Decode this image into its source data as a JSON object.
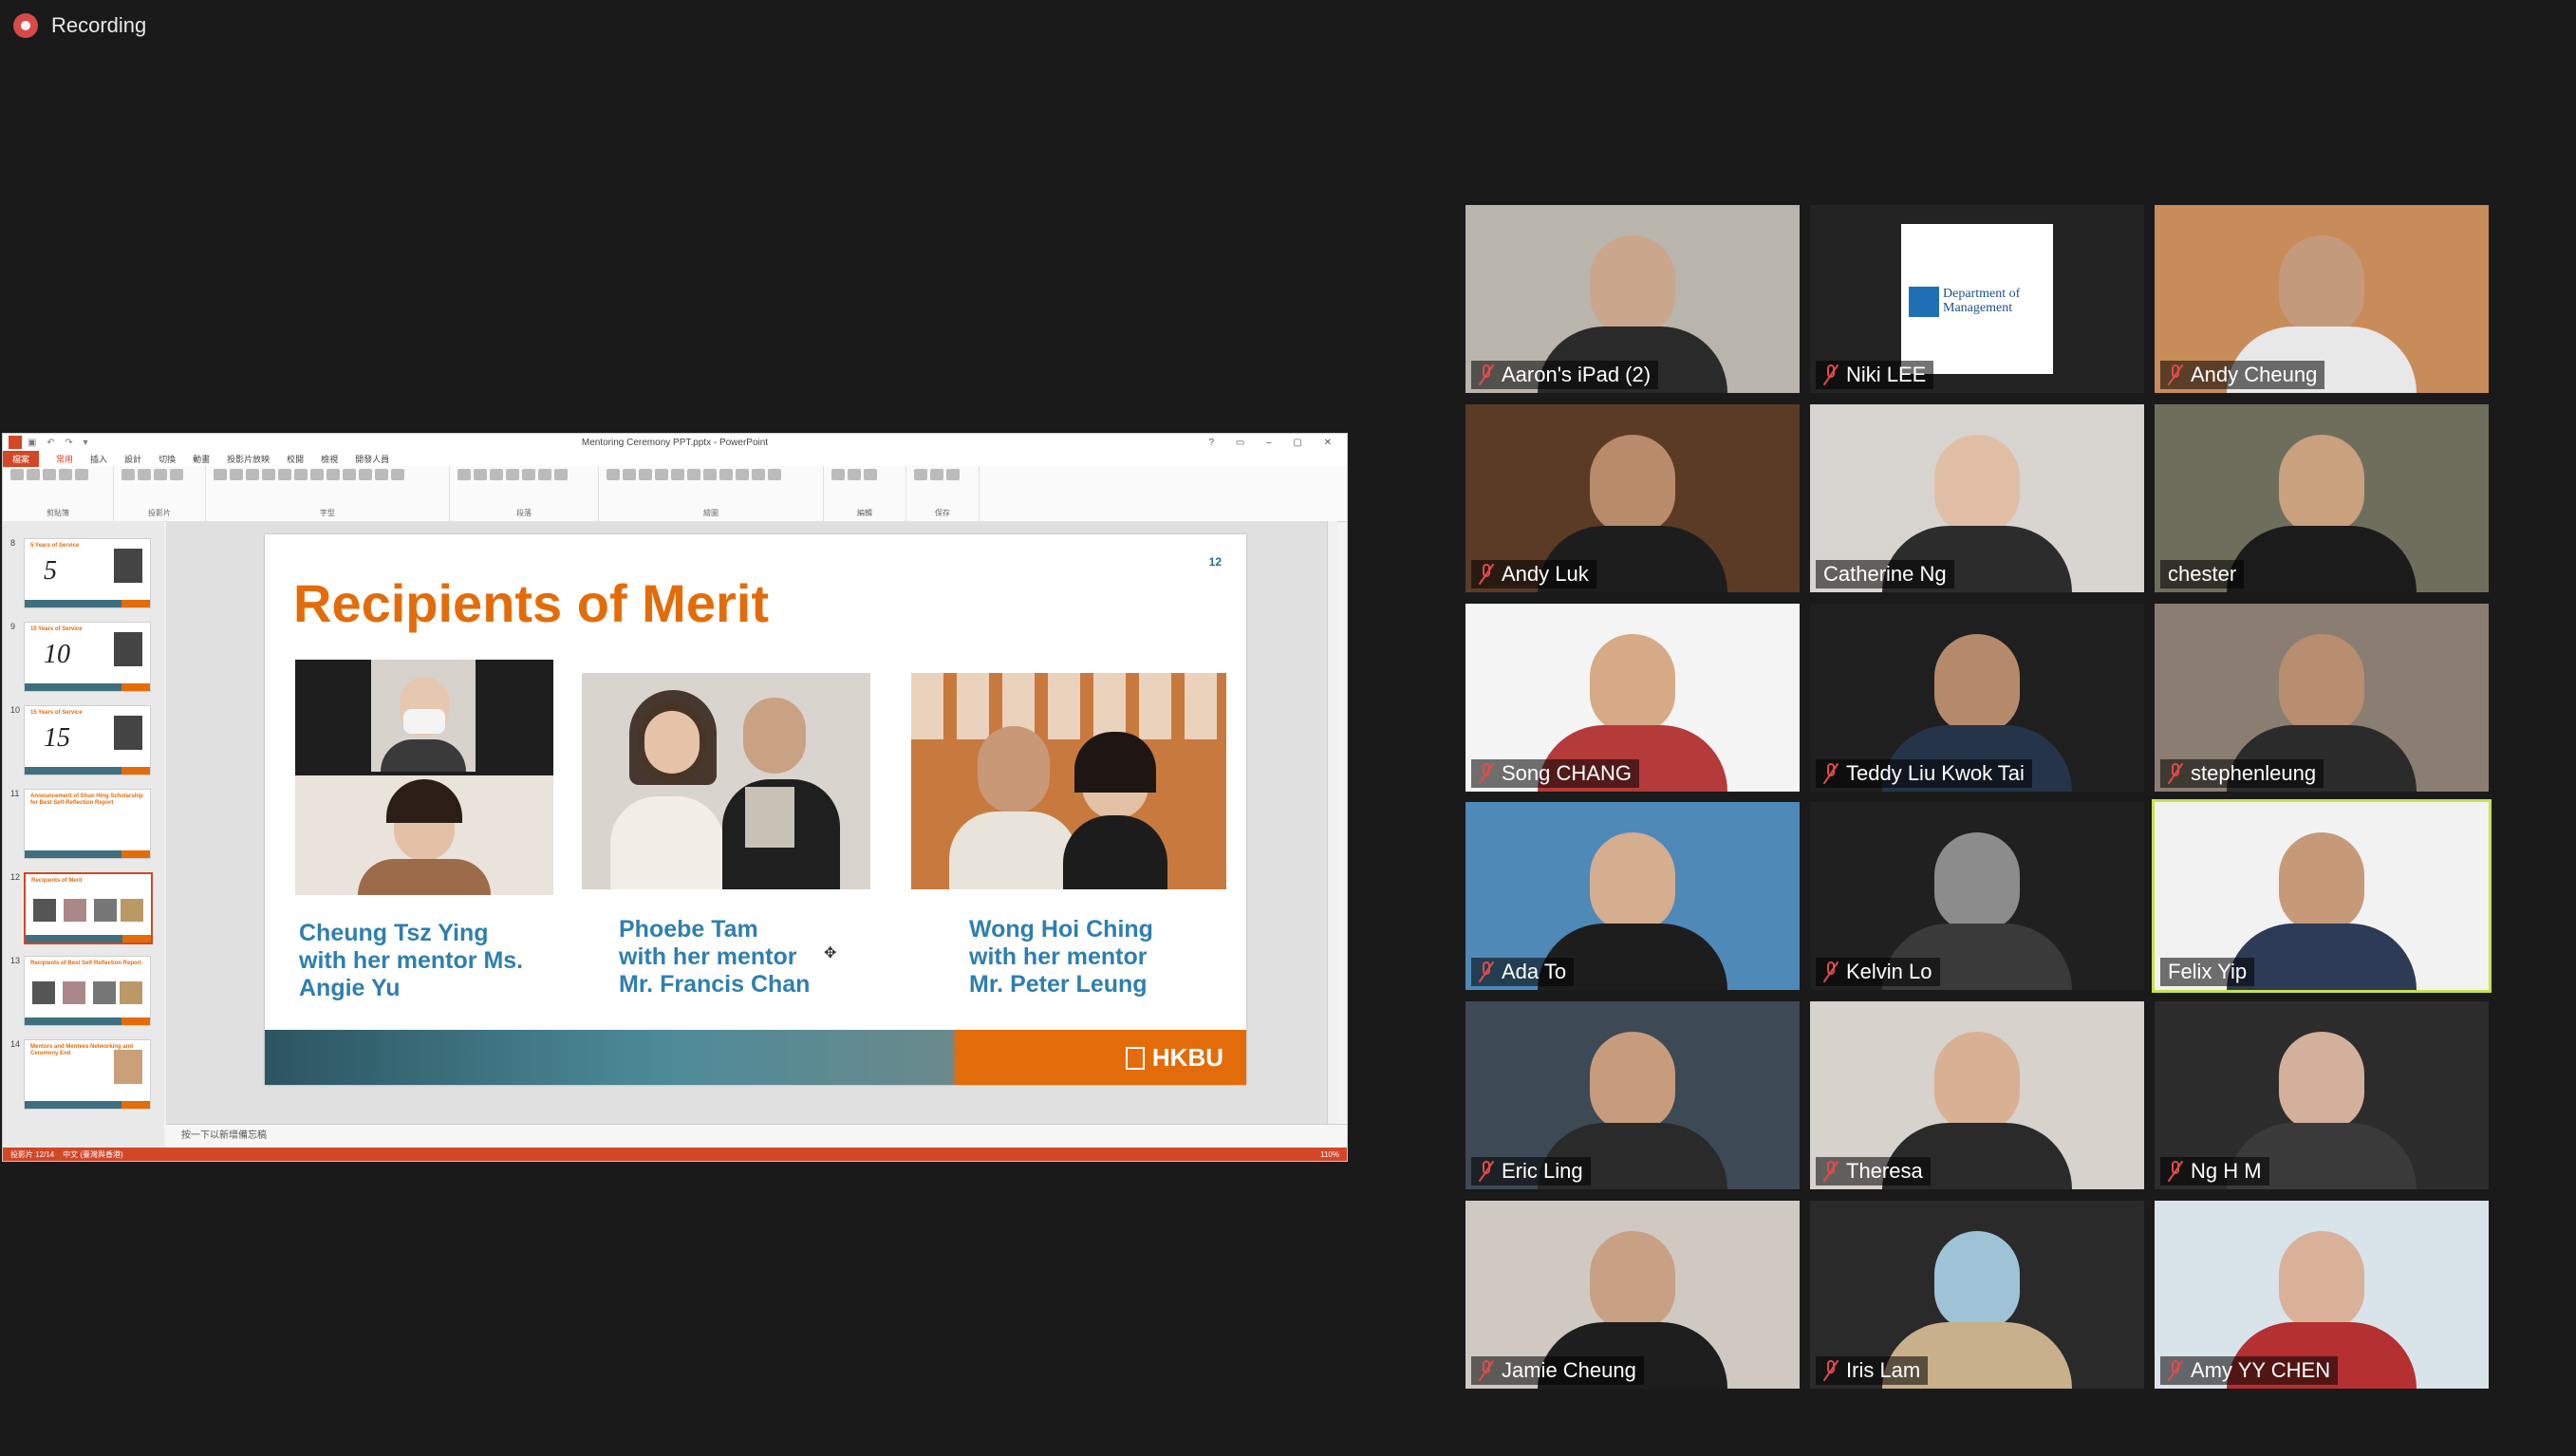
{
  "recording": {
    "label": "Recording"
  },
  "powerpoint": {
    "window_title": "Mentoring Ceremony PPT.pptx - PowerPoint",
    "ribbon_tabs": [
      "檔案",
      "常用",
      "插入",
      "設計",
      "切換",
      "動畫",
      "投影片放映",
      "校閱",
      "檢視",
      "開發人員"
    ],
    "ribbon_groups": [
      "剪貼簿",
      "投影片",
      "字型",
      "段落",
      "繪圖",
      "編輯",
      "保存"
    ],
    "thumbnails": [
      {
        "num": "8",
        "title": "5 Years of Service",
        "big": "5"
      },
      {
        "num": "9",
        "title": "10 Years of Service",
        "big": "10"
      },
      {
        "num": "10",
        "title": "15 Years of Service",
        "big": "15"
      },
      {
        "num": "11",
        "title": "Announcement of Shun Hing Scholarship for Best Self-Reflection Report",
        "big": ""
      },
      {
        "num": "12",
        "title": "Recipients of Merit",
        "big": ""
      },
      {
        "num": "13",
        "title": "Recipients of Best Self-Reflection Report",
        "big": ""
      },
      {
        "num": "14",
        "title": "Mentors and Mentees Networking and Ceremony End",
        "big": ""
      }
    ],
    "slide": {
      "title": "Recipients of Merit",
      "number": "12",
      "recipients": [
        {
          "line1": "Cheung Tsz Ying",
          "line2": "with her mentor Ms.",
          "line3": "Angie Yu"
        },
        {
          "line1": "Phoebe Tam",
          "line2": "with her mentor",
          "line3": "Mr. Francis Chan"
        },
        {
          "line1": "Wong Hoi Ching",
          "line2": "with her mentor",
          "line3": "Mr. Peter Leung"
        }
      ],
      "logo": "HKBU"
    },
    "notes_placeholder": "按一下以新增備忘稿",
    "status_left": "投影片 12/14",
    "status_lang": "中文 (臺灣與香港)",
    "status_zoom": "110%"
  },
  "participants": [
    {
      "name": "Aaron's iPad (2)",
      "muted": true,
      "speaking": false,
      "bg": "#b9b4ac",
      "skin": "#caa68c",
      "shirt": "#2a2a2a",
      "logo": false
    },
    {
      "name": "Niki LEE",
      "muted": true,
      "speaking": false,
      "bg": "#232323",
      "skin": "",
      "shirt": "",
      "logo": true,
      "logo_text": "Department of Management"
    },
    {
      "name": "Andy Cheung",
      "muted": true,
      "speaking": false,
      "bg": "#c88b5a",
      "skin": "#c49a7c",
      "shirt": "#e8e8e8",
      "logo": false
    },
    {
      "name": "Andy Luk",
      "muted": true,
      "speaking": false,
      "bg": "#5b3a26",
      "skin": "#b88b6a",
      "shirt": "#1d1d1d",
      "logo": false
    },
    {
      "name": "Catherine Ng",
      "muted": false,
      "speaking": false,
      "bg": "#d8d4cf",
      "skin": "#e1bfa6",
      "shirt": "#2c2c2c",
      "logo": false
    },
    {
      "name": "chester",
      "muted": false,
      "speaking": false,
      "bg": "#6e6e5c",
      "skin": "#c9a17f",
      "shirt": "#1b1b1b",
      "logo": false
    },
    {
      "name": "Song CHANG",
      "muted": true,
      "speaking": false,
      "bg": "#f4f4f4",
      "skin": "#d6aa86",
      "shirt": "#b53a3a",
      "logo": false
    },
    {
      "name": "Teddy Liu Kwok Tai",
      "muted": true,
      "speaking": false,
      "bg": "#1f1f1f",
      "skin": "#b58a6b",
      "shirt": "#26344a",
      "logo": false
    },
    {
      "name": "stephenleung",
      "muted": true,
      "speaking": false,
      "bg": "#8a7e72",
      "skin": "#b88d70",
      "shirt": "#2b2b2b",
      "logo": false
    },
    {
      "name": "Ada To",
      "muted": true,
      "speaking": false,
      "bg": "#4f89b8",
      "skin": "#d5ad8f",
      "shirt": "#1d1d1d",
      "logo": false
    },
    {
      "name": "Kelvin Lo",
      "muted": true,
      "speaking": false,
      "bg": "#202020",
      "skin": "#8c8c8c",
      "shirt": "#3a3a3a",
      "logo": false
    },
    {
      "name": "Felix Yip",
      "muted": false,
      "speaking": true,
      "bg": "#f2f2f2",
      "skin": "#c69a78",
      "shirt": "#2d3b57",
      "logo": false
    },
    {
      "name": "Eric Ling",
      "muted": true,
      "speaking": false,
      "bg": "#3d4a55",
      "skin": "#c79c7c",
      "shirt": "#2a2a2a",
      "logo": false
    },
    {
      "name": "Theresa",
      "muted": true,
      "speaking": false,
      "bg": "#d7d2cc",
      "skin": "#d8b194",
      "shirt": "#2a2a2a",
      "logo": false
    },
    {
      "name": "Ng H M",
      "muted": true,
      "speaking": false,
      "bg": "#2c2c2c",
      "skin": "#d3b09b",
      "shirt": "#3a3a3a",
      "logo": false
    },
    {
      "name": "Jamie Cheung",
      "muted": true,
      "speaking": false,
      "bg": "#cfc9c2",
      "skin": "#c8a083",
      "shirt": "#1e1e1e",
      "logo": false
    },
    {
      "name": "Iris Lam",
      "muted": true,
      "speaking": false,
      "bg": "#2a2a2a",
      "skin": "#9ec3d6",
      "shirt": "#c8b08a",
      "logo": false
    },
    {
      "name": "Amy YY CHEN",
      "muted": true,
      "speaking": false,
      "bg": "#d9e3ea",
      "skin": "#d9b198",
      "shirt": "#b53030",
      "logo": false
    }
  ]
}
